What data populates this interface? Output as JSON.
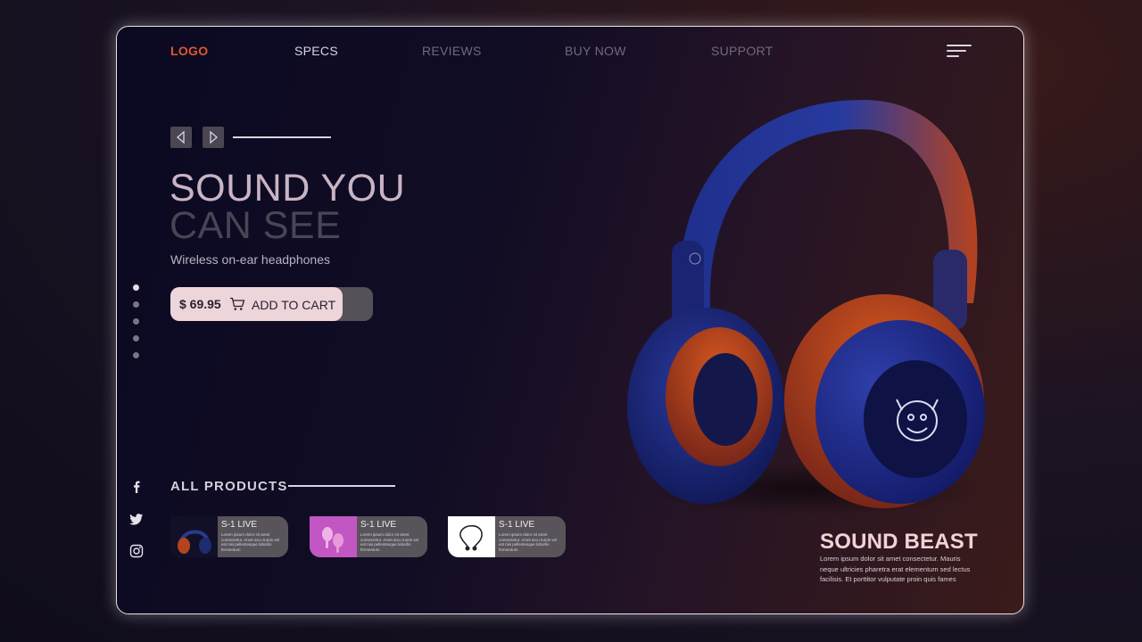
{
  "nav": {
    "logo": "LOGO",
    "items": [
      {
        "label": "SPECS"
      },
      {
        "label": "REVIEWS"
      },
      {
        "label": "BUY NOW"
      },
      {
        "label": "SUPPORT"
      }
    ]
  },
  "hero": {
    "headline_line1": "SOUND YOU",
    "headline_line2": "CAN SEE",
    "subtitle": "Wireless on-ear headphones",
    "price": "$ 69.95",
    "add_to_cart": "ADD TO CART"
  },
  "pagination": {
    "count": 5,
    "active_index": 0
  },
  "social": {
    "icons": [
      "facebook-icon",
      "twitter-icon",
      "instagram-icon"
    ]
  },
  "products": {
    "heading": "ALL PRODUCTS",
    "items": [
      {
        "name": "S-1 LIVE",
        "desc": "Lorem ipsum dolor sit amet consectetur. Amet arcu turpis vel est nisi pellentesque lobortis fermentum"
      },
      {
        "name": "S-1 LIVE",
        "desc": "Lorem ipsum dolor sit amet consectetur. Amet arcu turpis vel est nisi pellentesque lobortis fermentum"
      },
      {
        "name": "S-1 LIVE",
        "desc": "Lorem ipsum dolor sit amet consectetur. Amet arcu turpis vel est nisi pellentesque lobortis fermentum"
      }
    ]
  },
  "feature": {
    "title": "SOUND BEAST",
    "desc": "Lorem ipsum dolor sit amet consectetur. Mauris neque ultricies pharetra erat elementum sed lectus facilisis. Et porttitor vulputate proin quis fames"
  },
  "colors": {
    "accent": "#e0572e",
    "button": "#eed5da",
    "title": "#f2d2d6"
  }
}
